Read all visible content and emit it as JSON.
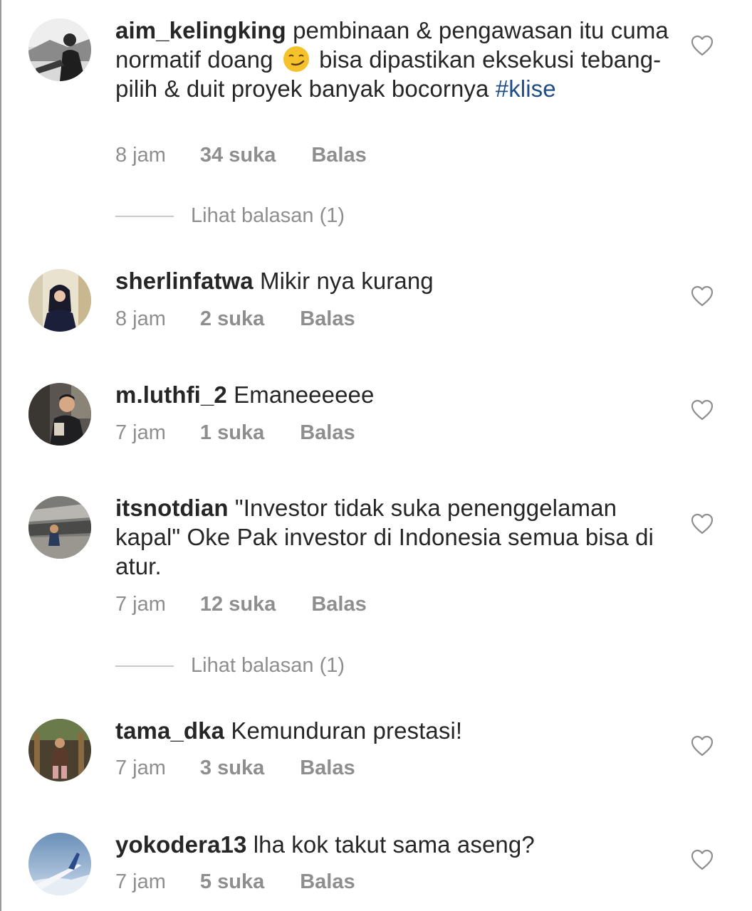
{
  "comments": [
    {
      "username": "aim_kelingking",
      "text_before_emoji": " pembinaan & pengawasan itu cuma normatif doang ",
      "emoji": "smirking-face",
      "text_after_emoji": " bisa dipastikan eksekusi tebang-pilih & duit proyek banyak bocornya ",
      "hashtag": "#klise",
      "time": "8 jam",
      "likes": "34 suka",
      "reply": "Balas",
      "view_replies": "Lihat balasan (1)"
    },
    {
      "username": "sherlinfatwa",
      "text": " Mikir nya kurang",
      "time": "8 jam",
      "likes": "2 suka",
      "reply": "Balas"
    },
    {
      "username": "m.luthfi_2",
      "text": " Emaneeeeee",
      "time": "7 jam",
      "likes": "1 suka",
      "reply": "Balas"
    },
    {
      "username": "itsnotdian",
      "text": " \"Investor tidak suka penenggelaman kapal\" Oke Pak investor di Indonesia semua bisa di atur.",
      "time": "7 jam",
      "likes": "12 suka",
      "reply": "Balas",
      "view_replies": "Lihat balasan (1)"
    },
    {
      "username": "tama_dka",
      "text": " Kemunduran prestasi!",
      "time": "7 jam",
      "likes": "3 suka",
      "reply": "Balas"
    },
    {
      "username": "yokodera13",
      "text": " lha kok takut sama aseng?",
      "time": "7 jam",
      "likes": "5 suka",
      "reply": "Balas"
    }
  ],
  "icons": {
    "like": "heart-outline-icon"
  },
  "colors": {
    "text": "#262626",
    "meta": "#8e8e8e",
    "hashtag": "#1f4e86"
  }
}
